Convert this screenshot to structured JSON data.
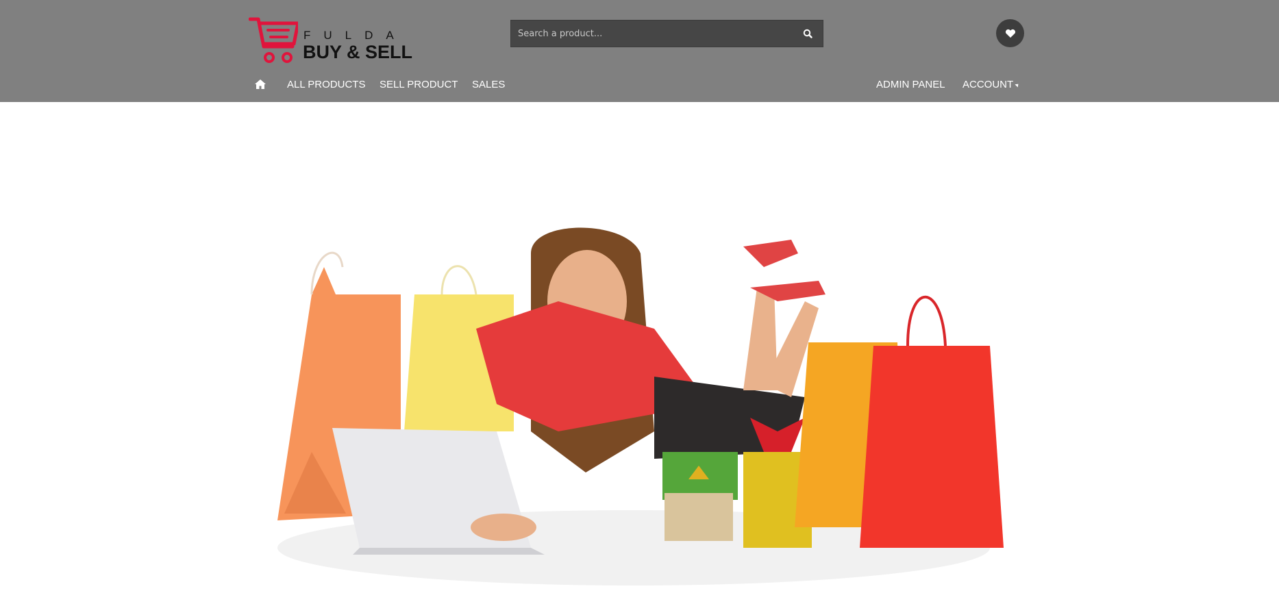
{
  "header": {
    "logo": {
      "line1": "FULDA",
      "line2": "BUY & SELL",
      "icon": "shopping-cart-icon",
      "accent_color": "#e0143c"
    },
    "search": {
      "placeholder": "Search a product...",
      "value": "",
      "icon": "search-icon"
    },
    "wishlist_icon": "heart-icon",
    "background_color": "#808080"
  },
  "nav": {
    "home_icon": "home-icon",
    "left_items": [
      {
        "label": "ALL PRODUCTS"
      },
      {
        "label": "SELL PRODUCT"
      },
      {
        "label": "SALES"
      }
    ],
    "right_items": [
      {
        "label": "ADMIN PANEL"
      },
      {
        "label": "ACCOUNT"
      }
    ]
  },
  "hero": {
    "image": "woman-shopping-laptop-with-bags"
  }
}
